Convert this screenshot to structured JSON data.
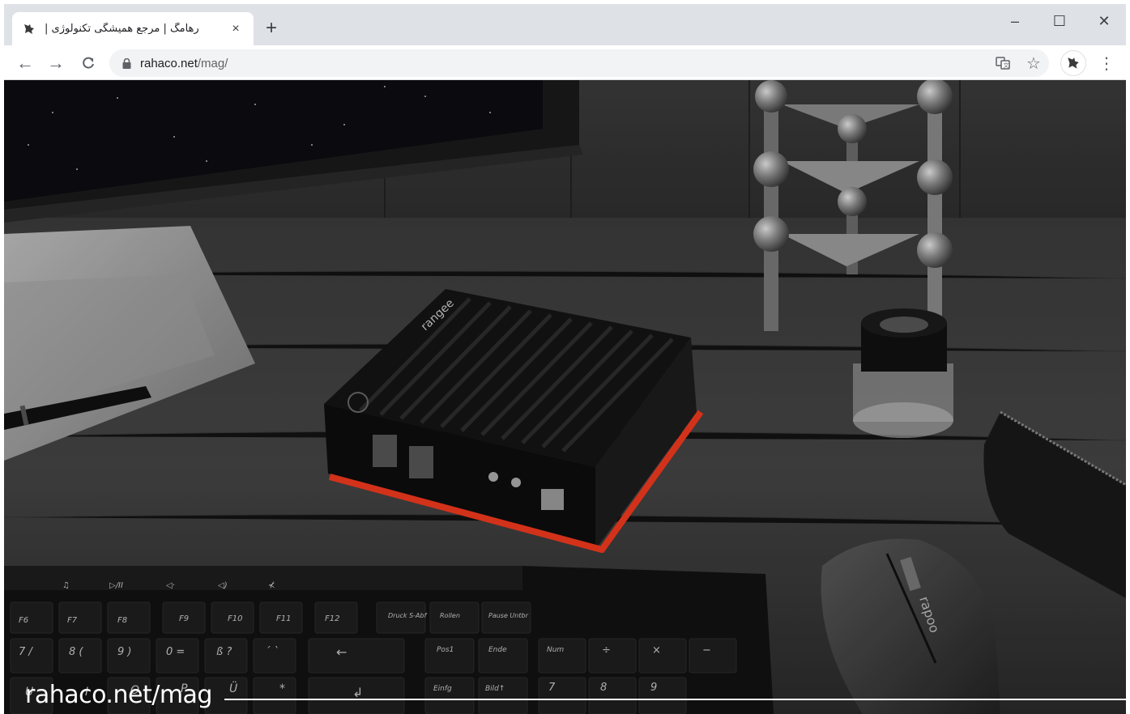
{
  "browser": {
    "tab": {
      "title": "رهامگ | مرجع همیشگی تکنولوژی |",
      "favicon": "rahaco-logo-icon",
      "close_icon": "×"
    },
    "new_tab_icon": "+",
    "window_controls": {
      "minimize": "–",
      "maximize": "☐",
      "close": "✕"
    },
    "nav": {
      "back": "←",
      "forward": "→",
      "reload": "C"
    },
    "address": {
      "host": "rahaco.net",
      "path": "/mag/"
    },
    "toolbar_icons": [
      "translate-icon",
      "star-icon",
      "extension-icon",
      "menu-icon"
    ]
  },
  "hero": {
    "caption": "rahaco.net/mag",
    "accent_color": "#f0391e",
    "device_brand": "rangee",
    "mouse_brand": "rapoo",
    "keyboard_keys": {
      "media": [
        "",
        "♫",
        "▷/II",
        "◁·",
        "◁)",
        "⊀"
      ],
      "function": [
        "F6",
        "F7",
        "F8",
        "F9",
        "F10",
        "F11",
        "F12",
        "Druck S-Abf",
        "Rollen",
        "Pause Untbr"
      ],
      "row2": [
        "7 /",
        "8 (",
        "9 )",
        "0 =",
        "ß ?",
        "´ `",
        "←",
        "Pos1",
        "Ende",
        "Num",
        "÷",
        "×",
        "−"
      ],
      "row3": [
        "U",
        "I",
        "O",
        "P",
        "Ü",
        "*",
        "↲",
        "Einfg",
        "Bild↑",
        "7",
        "8",
        "9"
      ]
    }
  }
}
